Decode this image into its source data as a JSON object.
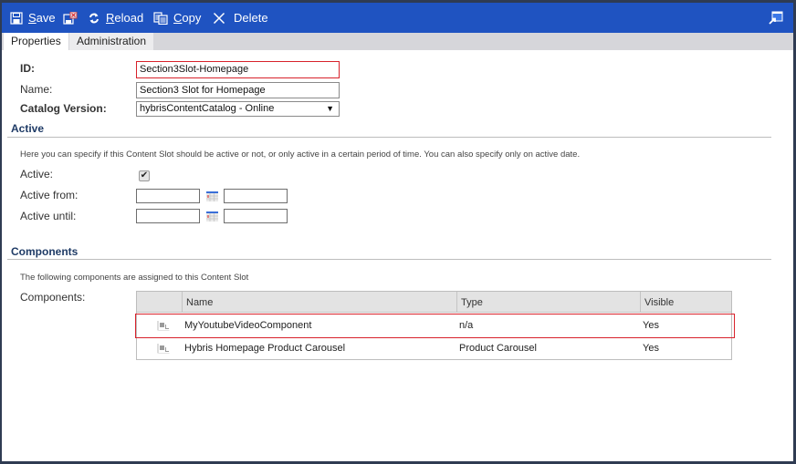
{
  "toolbar": {
    "save_label": "Save",
    "save_mnemonic": "S",
    "save_rest": "ave",
    "reload_label": "Reload",
    "reload_mnemonic": "R",
    "reload_rest": "eload",
    "copy_label": "Copy",
    "copy_mnemonic": "C",
    "copy_rest": "opy",
    "delete_label": "Delete",
    "icons": {
      "save": "save-icon",
      "discard": "discard-changes-icon",
      "reload": "reload-icon",
      "copy": "copy-icon",
      "delete": "delete-icon",
      "popout": "popout-window-icon"
    }
  },
  "tabs": [
    {
      "label": "Properties",
      "active": true
    },
    {
      "label": "Administration",
      "active": false
    }
  ],
  "form": {
    "id_label": "ID:",
    "id_value": "Section3Slot-Homepage",
    "name_label": "Name:",
    "name_value": "Section3 Slot for Homepage",
    "catalog_label": "Catalog Version:",
    "catalog_value": "hybrisContentCatalog - Online"
  },
  "active_section": {
    "title": "Active",
    "hint": "Here you can specify if this Content Slot should be active or not, or only active in a certain period of time. You can also specify only on active date.",
    "active_label": "Active:",
    "active_checked": true,
    "active_from_label": "Active from:",
    "active_from_date": "",
    "active_from_time": "",
    "active_until_label": "Active until:",
    "active_until_date": "",
    "active_until_time": ""
  },
  "components_section": {
    "title": "Components",
    "hint": "The following components are assigned to this Content Slot",
    "components_label": "Components:",
    "columns": [
      "",
      "Name",
      "Type",
      "Visible"
    ],
    "rows": [
      {
        "name": "MyYoutubeVideoComponent",
        "type": "n/a",
        "visible": "Yes",
        "highlighted": true
      },
      {
        "name": "Hybris Homepage Product Carousel",
        "type": "Product Carousel",
        "visible": "Yes",
        "highlighted": false
      }
    ]
  },
  "colors": {
    "toolbar": "#1f53c1",
    "highlight": "#d8222b",
    "frame": "#2f3b52"
  }
}
